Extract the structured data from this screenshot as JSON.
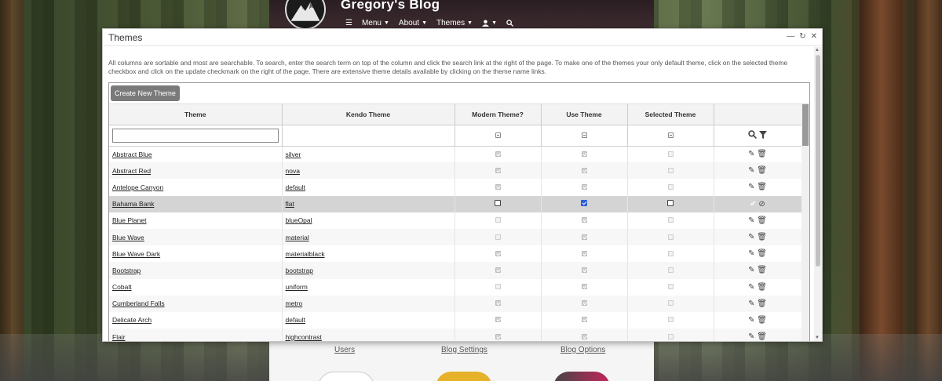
{
  "blog": {
    "title": "Gregory's Blog",
    "nav": {
      "menu": "Menu",
      "about": "About",
      "themes": "Themes"
    },
    "bottom_links": {
      "users": "Users",
      "blog_settings": "Blog Settings",
      "blog_options": "Blog Options"
    }
  },
  "dialog": {
    "title": "Themes",
    "intro": "All columns are sortable and most are searchable. To search, enter the search term on top of the column and click the search link at the right of the page. To make one of the themes your only default theme, click on the selected theme checkbox and click on the update checkmark on the right of the page. There are extensive theme details available by clicking on the theme name links.",
    "create_button": "Create New Theme",
    "columns": {
      "theme": "Theme",
      "kendo": "Kendo Theme",
      "modern": "Modern Theme?",
      "use": "Use Theme",
      "selected": "Selected Theme"
    },
    "filter_placeholder": "",
    "rows": [
      {
        "theme": "Abstract Blue",
        "kendo": "silver",
        "modern": true,
        "use": true,
        "selected": false
      },
      {
        "theme": "Abstract Red",
        "kendo": "nova",
        "modern": true,
        "use": true,
        "selected": false
      },
      {
        "theme": "Antelope Canyon",
        "kendo": "default",
        "modern": true,
        "use": true,
        "selected": false
      },
      {
        "theme": "Bahama Bank",
        "kendo": "flat",
        "modern": false,
        "use": true,
        "selected": false,
        "editing": true
      },
      {
        "theme": "Blue Planet",
        "kendo": "blueOpal",
        "modern": false,
        "use": true,
        "selected": false
      },
      {
        "theme": "Blue Wave",
        "kendo": "material",
        "modern": false,
        "use": true,
        "selected": false
      },
      {
        "theme": "Blue Wave Dark",
        "kendo": "materialblack",
        "modern": true,
        "use": true,
        "selected": false
      },
      {
        "theme": "Bootstrap",
        "kendo": "bootstrap",
        "modern": true,
        "use": true,
        "selected": false
      },
      {
        "theme": "Cobalt",
        "kendo": "uniform",
        "modern": false,
        "use": true,
        "selected": false
      },
      {
        "theme": "Cumberland Falls",
        "kendo": "metro",
        "modern": true,
        "use": true,
        "selected": false
      },
      {
        "theme": "Delicate Arch",
        "kendo": "default",
        "modern": true,
        "use": true,
        "selected": false
      },
      {
        "theme": "Flair",
        "kendo": "highcontrast",
        "modern": true,
        "use": true,
        "selected": false
      }
    ]
  },
  "colors": {
    "accent_checkbox": "#2b5fd9",
    "create_button_bg": "#7a7a7a",
    "selected_row": "#d4d4d4"
  }
}
